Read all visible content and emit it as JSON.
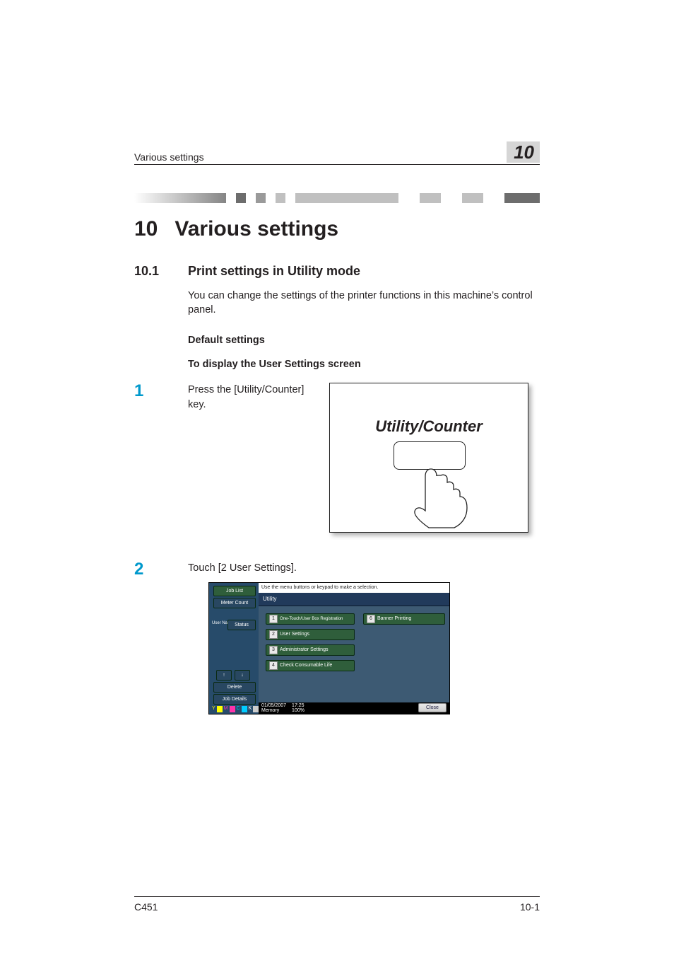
{
  "header": {
    "left": "Various settings",
    "rightNum": "10"
  },
  "h1": {
    "num": "10",
    "title": "Various settings"
  },
  "h2": {
    "num": "10.1",
    "title": "Print settings in Utility mode"
  },
  "intro": "You can change the settings of the printer functions in this machine’s control panel.",
  "sub1": "Default settings",
  "sub2": "To display the User Settings screen",
  "steps": {
    "s1num": "1",
    "s1text": "Press the [Utility/Counter] key.",
    "s2num": "2",
    "s2text": "Touch [2 User Settings]."
  },
  "utilityKey": {
    "label": "Utility/Counter"
  },
  "touchscreen": {
    "topMsg": "Use the menu buttons or keypad to make a selection.",
    "crumb": "Utility",
    "left": {
      "jobList": "Job List",
      "meterCount": "Meter Count",
      "status": "Status",
      "delete": "Delete",
      "jobDetails": "Job Details",
      "userName": "User Name"
    },
    "buttons": {
      "b1": {
        "n": "1",
        "label": "One-Touch/User Box Registration"
      },
      "b2": {
        "n": "2",
        "label": "User Settings"
      },
      "b3": {
        "n": "3",
        "label": "Administrator Settings"
      },
      "b4": {
        "n": "4",
        "label": "Check Consumable Life"
      },
      "b6": {
        "n": "6",
        "label": "Banner Printing"
      }
    },
    "footer": {
      "date": "01/05/2007",
      "time": "17:25",
      "memLabel": "Memory",
      "memVal": "100%",
      "close": "Close"
    },
    "ymck": {
      "y": "Y",
      "m": "M",
      "c": "C",
      "k": "K"
    }
  },
  "footer": {
    "left": "C451",
    "right": "10-1"
  }
}
